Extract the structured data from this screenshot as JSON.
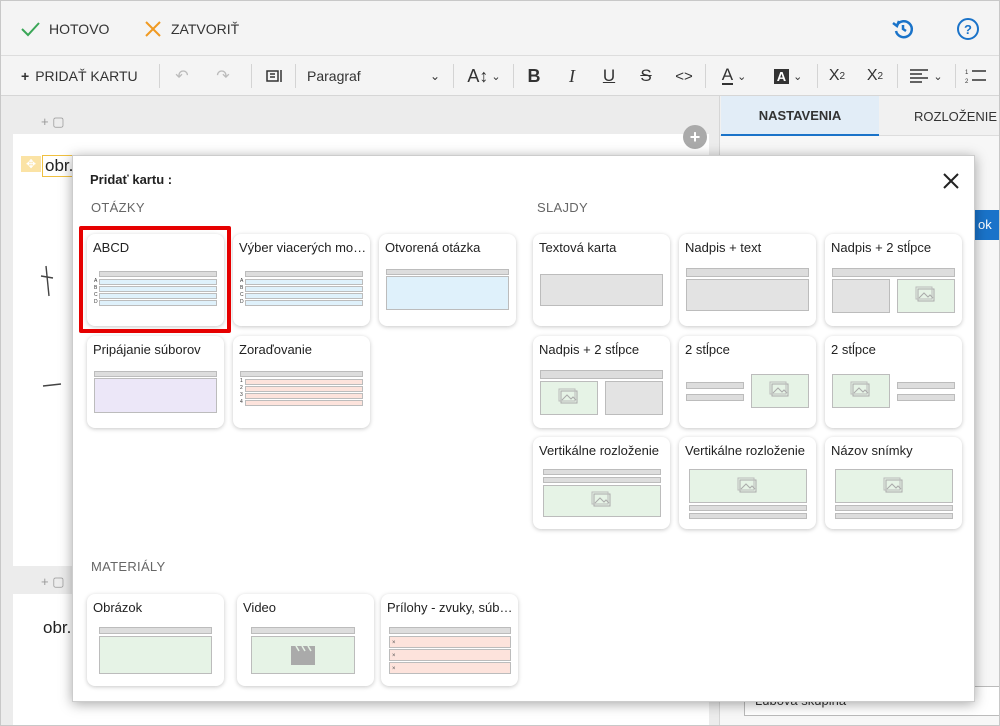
{
  "topbar": {
    "done_label": "HOTOVO",
    "close_label": "ZATVORIŤ"
  },
  "toolbar": {
    "add_card_label": "PRIDAŤ KARTU",
    "paragraph_value": "Paragraf"
  },
  "right_panel": {
    "tab_settings": "NASTAVENIA",
    "tab_layout": "ROZLOŽENIE",
    "button_fragment": "ok",
    "bottom_field": "Lubová skupina"
  },
  "editor": {
    "card_text_1": "obr.",
    "card_text_2": "obr."
  },
  "modal": {
    "title": "Pridať kartu :",
    "section_questions": "OTÁZKY",
    "section_slides": "SLAJDY",
    "section_materials": "MATERIÁLY",
    "questions": [
      "ABCD",
      "Výber viacerých možností",
      "Otvorená otázka",
      "Pripájanie súborov",
      "Zoraďovanie"
    ],
    "slides": [
      "Textová karta",
      "Nadpis + text",
      "Nadpis + 2 stĺpce",
      "Nadpis + 2 stĺpce",
      "2 stĺpce",
      "2 stĺpce",
      "Vertikálne rozloženie",
      "Vertikálne rozloženie",
      "Názov snímky"
    ],
    "materials": [
      "Obrázok",
      "Video",
      "Prílohy - zvuky, súbory"
    ],
    "abcd_letters": [
      "A",
      "B",
      "C",
      "D"
    ],
    "order_numbers": [
      "1",
      "2",
      "3",
      "4"
    ],
    "attachment_marks": [
      "×",
      "×",
      "×"
    ]
  },
  "colors": {
    "accent_blue": "#1a73c9",
    "done_green": "#3aa657",
    "close_orange": "#f09a22",
    "highlight_red": "#e60000",
    "tab_active": "#e2edf7"
  }
}
